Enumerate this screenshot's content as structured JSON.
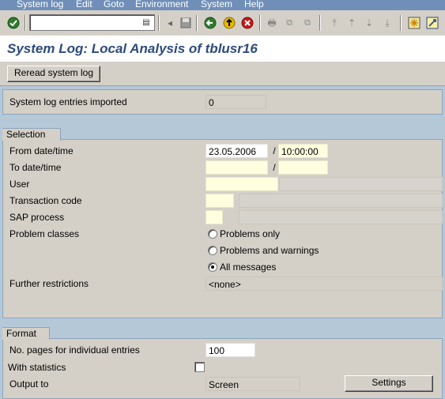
{
  "menu": [
    "System log",
    "Edit",
    "Goto",
    "Environment",
    "System",
    "Help"
  ],
  "toolbar": {
    "command_field": "",
    "icons": [
      "enter-icon",
      "back-icon",
      "exit-icon",
      "cancel-icon",
      "print-icon",
      "find-icon",
      "find-next-icon",
      "first-page-icon",
      "previous-page-icon",
      "next-page-icon",
      "last-page-icon",
      "create-session-icon",
      "help-icon"
    ]
  },
  "title": "System Log: Local Analysis of tblusr16",
  "app_toolbar": {
    "reread_button": "Reread system log"
  },
  "imported": {
    "label": "System log entries imported",
    "value": "0"
  },
  "selection": {
    "header": "Selection",
    "from_label": "From date/time",
    "from_date": "23.05.2006",
    "date_time_sep": "/",
    "from_time": "10:00:00",
    "to_label": "To date/time",
    "to_date": "",
    "to_time": "",
    "user_label": "User",
    "tcode_label": "Transaction code",
    "process_label": "SAP process",
    "problem_label": "Problem classes",
    "problem_options": [
      "Problems only",
      "Problems and warnings",
      "All messages"
    ],
    "problem_selected": "All messages",
    "further_label": "Further restrictions",
    "further_value": "<none>"
  },
  "format": {
    "header": "Format",
    "pages_label": "No. pages for individual entries",
    "pages_value": "100",
    "stats_label": "With statistics",
    "stats_checked": false,
    "output_label": "Output to",
    "output_value": "Screen",
    "settings_button": "Settings"
  }
}
